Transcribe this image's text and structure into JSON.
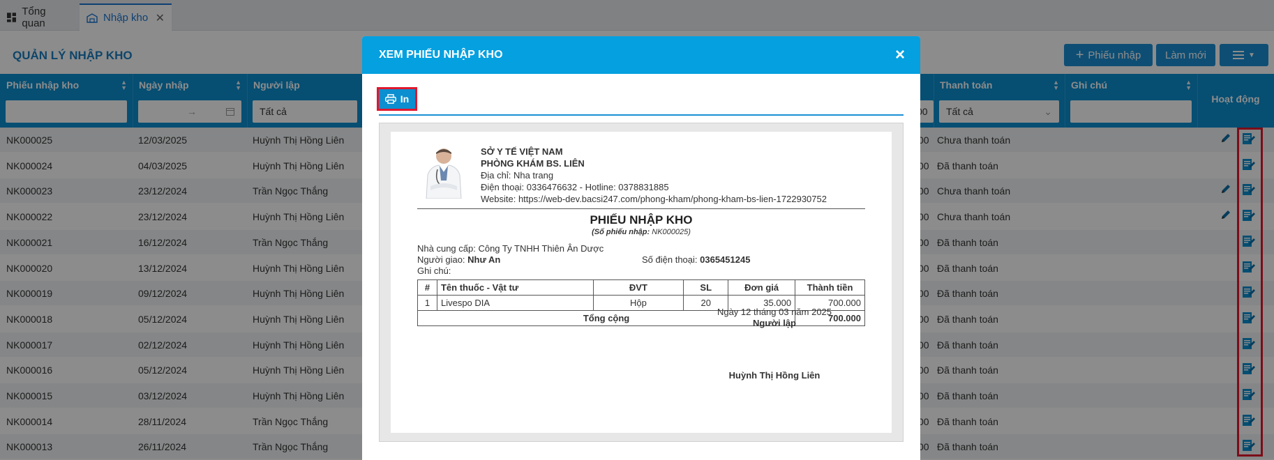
{
  "tabs": [
    {
      "label": "Tổng quan",
      "icon": "dashboard-icon"
    },
    {
      "label": "Nhập kho",
      "icon": "warehouse-icon"
    }
  ],
  "page": {
    "title": "QUẢN LÝ NHẬP KHO",
    "buttons": {
      "add": "Phiếu nhập",
      "refresh": "Làm mới"
    }
  },
  "table": {
    "columns": {
      "code": "Phiếu nhập kho",
      "date": "Ngày nhập",
      "creator": "Người lập",
      "payment": "Thanh toán",
      "note": "Ghi chú",
      "action": "Hoạt động",
      "partial_amount_header": "00"
    },
    "filters": {
      "date_separator": "→",
      "creator": "Tất cả",
      "payment": "Tất cả"
    },
    "rows": [
      {
        "code": "NK000025",
        "date": "12/03/2025",
        "creator": "Huỳnh Thị Hồng Liên",
        "amount": "00",
        "payment": "Chưa thanh toán",
        "editable": true
      },
      {
        "code": "NK000024",
        "date": "04/03/2025",
        "creator": "Huỳnh Thị Hồng Liên",
        "amount": "00",
        "payment": "Đã thanh toán",
        "editable": false
      },
      {
        "code": "NK000023",
        "date": "23/12/2024",
        "creator": "Trần Ngọc Thắng",
        "amount": "00",
        "payment": "Chưa thanh toán",
        "editable": true
      },
      {
        "code": "NK000022",
        "date": "23/12/2024",
        "creator": "Huỳnh Thị Hồng Liên",
        "amount": "00",
        "payment": "Chưa thanh toán",
        "editable": true
      },
      {
        "code": "NK000021",
        "date": "16/12/2024",
        "creator": "Trần Ngọc Thắng",
        "amount": "00",
        "payment": "Đã thanh toán",
        "editable": false
      },
      {
        "code": "NK000020",
        "date": "13/12/2024",
        "creator": "Huỳnh Thị Hồng Liên",
        "amount": "00",
        "payment": "Đã thanh toán",
        "editable": false
      },
      {
        "code": "NK000019",
        "date": "09/12/2024",
        "creator": "Huỳnh Thị Hồng Liên",
        "amount": "00",
        "payment": "Đã thanh toán",
        "editable": false
      },
      {
        "code": "NK000018",
        "date": "05/12/2024",
        "creator": "Huỳnh Thị Hồng Liên",
        "amount": "00",
        "payment": "Đã thanh toán",
        "editable": false
      },
      {
        "code": "NK000017",
        "date": "02/12/2024",
        "creator": "Huỳnh Thị Hồng Liên",
        "amount": "00",
        "payment": "Đã thanh toán",
        "editable": false
      },
      {
        "code": "NK000016",
        "date": "05/12/2024",
        "creator": "Huỳnh Thị Hồng Liên",
        "amount": "00",
        "payment": "Đã thanh toán",
        "editable": false
      },
      {
        "code": "NK000015",
        "date": "03/12/2024",
        "creator": "Huỳnh Thị Hồng Liên",
        "amount": "00",
        "payment": "Đã thanh toán",
        "editable": false
      },
      {
        "code": "NK000014",
        "date": "28/11/2024",
        "creator": "Trần Ngọc Thắng",
        "amount": "00",
        "payment": "Đã thanh toán",
        "editable": false
      },
      {
        "code": "NK000013",
        "date": "26/11/2024",
        "creator": "Trần Ngọc Thắng",
        "amount": "00",
        "payment": "Đã thanh toán",
        "editable": false
      }
    ]
  },
  "modal": {
    "title": "XEM PHIẾU NHẬP KHO",
    "print_label": "In",
    "sheet": {
      "org_line1": "SỞ Y TẾ VIỆT NAM",
      "org_line2": "PHÒNG KHÁM BS. LIÊN",
      "address": "Địa chỉ: Nha trang",
      "phone": "Điện thoại: 0336476632 - Hotline: 0378831885",
      "website": "Website: https://web-dev.bacsi247.com/phong-kham/phong-kham-bs-lien-1722930752",
      "title": "PHIẾU NHẬP KHO",
      "no_label": "(Số phiếu nhập:",
      "no_value": "NK000025)",
      "supplier": "Nhà cung cấp: Công Ty TNHH Thiên Ân Dược",
      "deliverer_label": "Người giao:",
      "deliverer": "Như An",
      "phone_label": "Số điện thoại:",
      "deliverer_phone": "0365451245",
      "note": "Ghi chú:",
      "columns": [
        "#",
        "Tên thuốc - Vật tư",
        "ĐVT",
        "SL",
        "Đơn giá",
        "Thành tiền"
      ],
      "items": [
        {
          "no": "1",
          "name": "Livespo DIA",
          "unit": "Hộp",
          "qty": "20",
          "price": "35.000",
          "total": "700.000"
        }
      ],
      "total_label": "Tổng cộng",
      "total_value": "700.000",
      "date_line": "Ngày 12 tháng 03 năm 2025",
      "signer_role": "Người lập",
      "signer_name": "Huỳnh Thị Hồng Liên"
    }
  },
  "colors": {
    "primary": "#0b8fd0",
    "header": "#04a0e0",
    "highlight": "#e0182d"
  }
}
